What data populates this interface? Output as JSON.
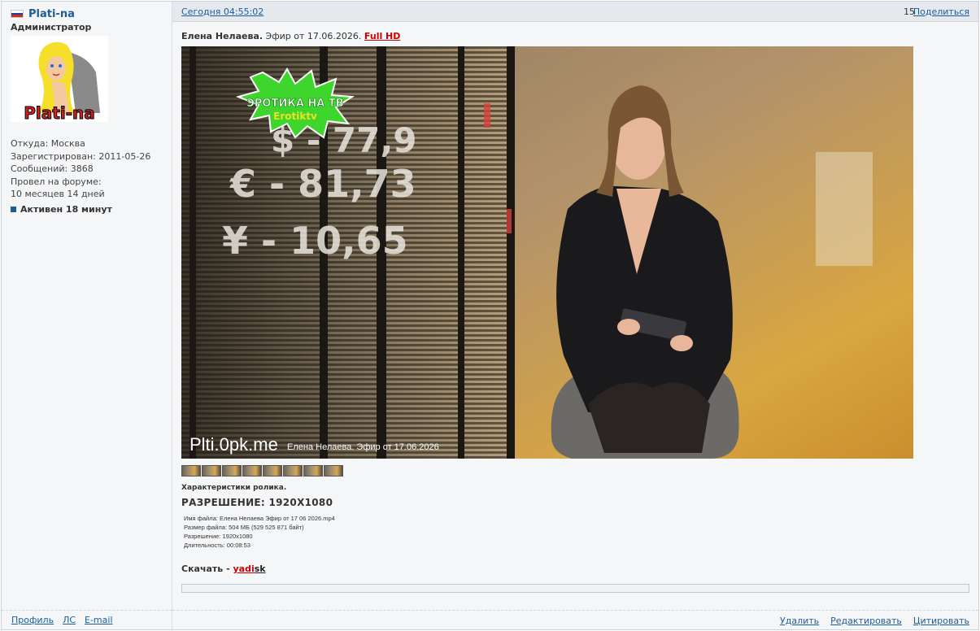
{
  "user": {
    "name": "Plati-na",
    "role": "Администратор",
    "from": "Откуда: Москва",
    "registered": "Зарегистрирован: 2011-05-26",
    "posts": "Сообщений: 3868",
    "forum_time_label": "Провел на форуме:",
    "forum_time": "10 месяцев 14 дней",
    "active": "Активен 18 минут",
    "avatar_text": "Plati-na"
  },
  "user_links": {
    "profile": "Профиль",
    "pm": "ЛС",
    "email": "E-mail"
  },
  "post": {
    "date": "Сегодня 04:55:02",
    "number": "15",
    "share": "Поделиться",
    "title_bold": "Елена Нелаева.",
    "title_rest": " Эфир от 17.06.2026. ",
    "title_hd": "Full HD"
  },
  "video": {
    "logo_line1": "ЭРОТИКА НА ТВ",
    "logo_line2": "Erotiktv",
    "watermark_big": "Plti.0pk.me",
    "watermark_small": "Елена Нелаева. Эфир от 17.06.2026",
    "board_line1": "$ - 77,9",
    "board_line2": "€ - 81,73",
    "board_line3": "¥ - 10,65"
  },
  "specs": {
    "heading": "Характеристики ролика.",
    "resolution_headline": "РАЗРЕШЕНИЕ: 1920X1080",
    "lines": [
      "Имя файла: Елена Нелаева Эфир от 17 06 2026.mp4",
      "Размер файла: 504 МБ (529 525 871 байт)",
      "Разрешение: 1920x1080",
      "Длительность: 00:08:53"
    ]
  },
  "download": {
    "label": "Скачать - ",
    "ya": "yadi",
    "disk": "sk"
  },
  "actions": {
    "delete": "Удалить",
    "edit": "Редактировать",
    "quote": "Цитировать"
  },
  "colors": {
    "link": "#1c5d98",
    "accent_red": "#cc0000",
    "panel_bg": "#f5f6f8",
    "topbar_bg": "#e5e9ed"
  }
}
